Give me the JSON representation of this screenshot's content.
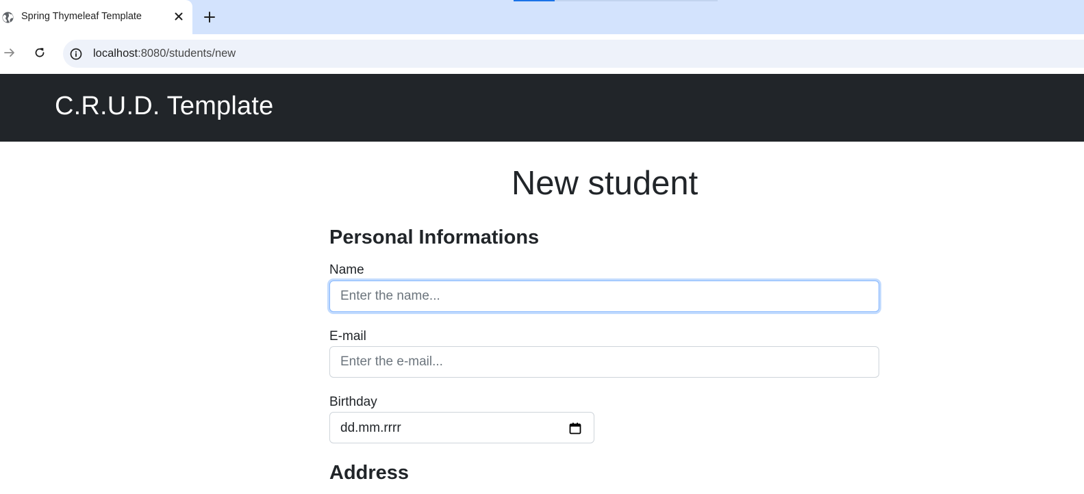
{
  "browser": {
    "tab": {
      "title": "Spring Thymeleaf Template",
      "favicon_icon": "globe-icon",
      "close_icon": "close-icon"
    },
    "new_tab_icon": "plus-icon",
    "nav": {
      "forward_icon": "arrow-right-icon",
      "reload_icon": "reload-icon"
    },
    "address_bar": {
      "info_icon": "info-icon",
      "host": "localhost",
      "path": ":8080/students/new"
    }
  },
  "navbar": {
    "brand": "C.R.U.D. Template"
  },
  "main": {
    "title": "New student",
    "personal_section": {
      "title": "Personal Informations",
      "name": {
        "label": "Name",
        "placeholder": "Enter the name...",
        "value": ""
      },
      "email": {
        "label": "E-mail",
        "placeholder": "Enter the e-mail...",
        "value": ""
      },
      "birthday": {
        "label": "Birthday",
        "value": "dd.mm.rrrr",
        "icon": "calendar-icon"
      }
    },
    "address_section": {
      "title": "Address"
    }
  },
  "colors": {
    "tab_strip": "#d3e3fd",
    "navbar_bg": "#212529",
    "focus_border": "#86b7fe",
    "input_border": "#ced4da"
  }
}
